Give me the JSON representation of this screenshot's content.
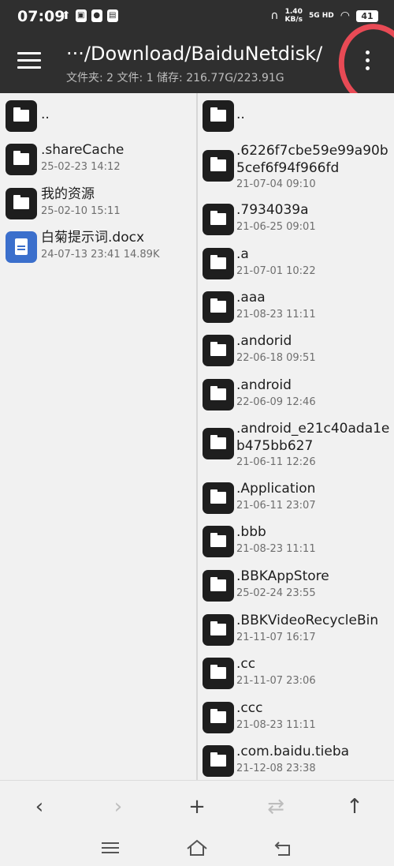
{
  "status_bar": {
    "time": "07:09",
    "notif_icons": [
      "upload-icon",
      "app-icon",
      "qq-icon",
      "app-icon"
    ],
    "speed_value": "1.40",
    "speed_unit": "KB/s",
    "network": "5G HD",
    "battery": "41"
  },
  "appbar": {
    "path": "···/Download/BaiduNetdisk/",
    "info": "文件夹: 2  文件: 1  储存: 216.77G/223.91G"
  },
  "left_pane": {
    "items": [
      {
        "type": "folder",
        "name": "..",
        "meta": ""
      },
      {
        "type": "folder",
        "name": ".shareCache",
        "meta": "25-02-23 14:12"
      },
      {
        "type": "folder",
        "name": "我的资源",
        "meta": "25-02-10 15:11"
      },
      {
        "type": "doc",
        "name": "白菊提示词.docx",
        "meta": "24-07-13 23:41  14.89K"
      }
    ]
  },
  "right_pane": {
    "items": [
      {
        "type": "folder",
        "name": "..",
        "meta": ""
      },
      {
        "type": "folder",
        "name": ".6226f7cbe59e99a90b5cef6f94f966fd",
        "meta": "21-07-04 09:10"
      },
      {
        "type": "folder",
        "name": ".7934039a",
        "meta": "21-06-25 09:01"
      },
      {
        "type": "folder",
        "name": ".a",
        "meta": "21-07-01 10:22"
      },
      {
        "type": "folder",
        "name": ".aaa",
        "meta": "21-08-23 11:11"
      },
      {
        "type": "folder",
        "name": ".andorid",
        "meta": "22-06-18 09:51"
      },
      {
        "type": "folder",
        "name": ".android",
        "meta": "22-06-09 12:46"
      },
      {
        "type": "folder",
        "name": ".android_e21c40ada1eb475bb627",
        "meta": "21-06-11 12:26"
      },
      {
        "type": "folder",
        "name": ".Application",
        "meta": "21-06-11 23:07"
      },
      {
        "type": "folder",
        "name": ".bbb",
        "meta": "21-08-23 11:11"
      },
      {
        "type": "folder",
        "name": ".BBKAppStore",
        "meta": "25-02-24 23:55"
      },
      {
        "type": "folder",
        "name": ".BBKVideoRecycleBin",
        "meta": "21-11-07 16:17"
      },
      {
        "type": "folder",
        "name": ".cc",
        "meta": "21-11-07 23:06"
      },
      {
        "type": "folder",
        "name": ".ccc",
        "meta": "21-08-23 11:11"
      },
      {
        "type": "folder",
        "name": ".com.baidu.tieba",
        "meta": "21-12-08 23:38"
      }
    ]
  },
  "bottom_bar": {
    "back": "‹",
    "forward": "›",
    "add": "+",
    "swap": "⇄",
    "up": "↑"
  },
  "colors": {
    "appbar_bg": "#2f2f2f",
    "annotation_circle": "#e84a55",
    "doc_icon": "#3b6fcc"
  }
}
